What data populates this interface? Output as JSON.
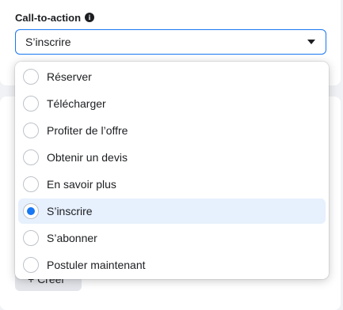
{
  "field": {
    "label": "Call-to-action",
    "selected_value": "S’inscrire"
  },
  "options": [
    {
      "label": "Réserver",
      "selected": false
    },
    {
      "label": "Télécharger",
      "selected": false
    },
    {
      "label": "Profiter de l’offre",
      "selected": false
    },
    {
      "label": "Obtenir un devis",
      "selected": false
    },
    {
      "label": "En savoir plus",
      "selected": false
    },
    {
      "label": "S’inscrire",
      "selected": true
    },
    {
      "label": "S’abonner",
      "selected": false
    },
    {
      "label": "Postuler maintenant",
      "selected": false
    }
  ],
  "behind": {
    "create_button_label": "+ Créer"
  },
  "colors": {
    "accent": "#1877f2",
    "selected_row": "#e7f0fd",
    "page_background": "#f0f2f5"
  }
}
